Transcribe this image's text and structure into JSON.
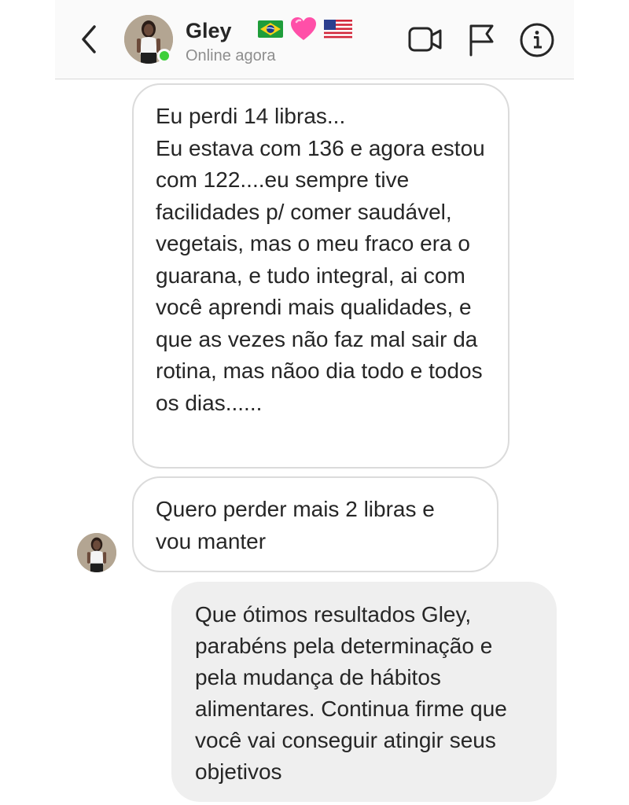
{
  "header": {
    "contact_name": "Gley",
    "status": "Online agora",
    "icons": [
      "back-chevron-icon",
      "brazil-flag-icon",
      "pink-heart-icon",
      "usa-flag-icon",
      "video-call-icon",
      "report-flag-icon",
      "info-icon"
    ],
    "colors": {
      "online_dot": "#3ecf3a",
      "heart": "#ff4fa8"
    }
  },
  "messages": [
    {
      "direction": "incoming",
      "text": "Eu perdi 14 libras...\nEu estava com 136 e agora estou com 122....eu sempre tive facilidades p/ comer saudável, vegetais, mas o meu fraco era o guarana, e tudo integral, ai com você aprendi mais qualidades, e que as vezes não faz mal sair da rotina, mas nãoo dia todo e todos os dias......"
    },
    {
      "direction": "incoming",
      "text": "Quero perder mais 2 libras e vou manter"
    },
    {
      "direction": "outgoing",
      "text": "Que ótimos resultados Gley, parabéns pela determinação e pela mudança de hábitos alimentares. Continua firme que você vai conseguir atingir seus objetivos"
    }
  ]
}
